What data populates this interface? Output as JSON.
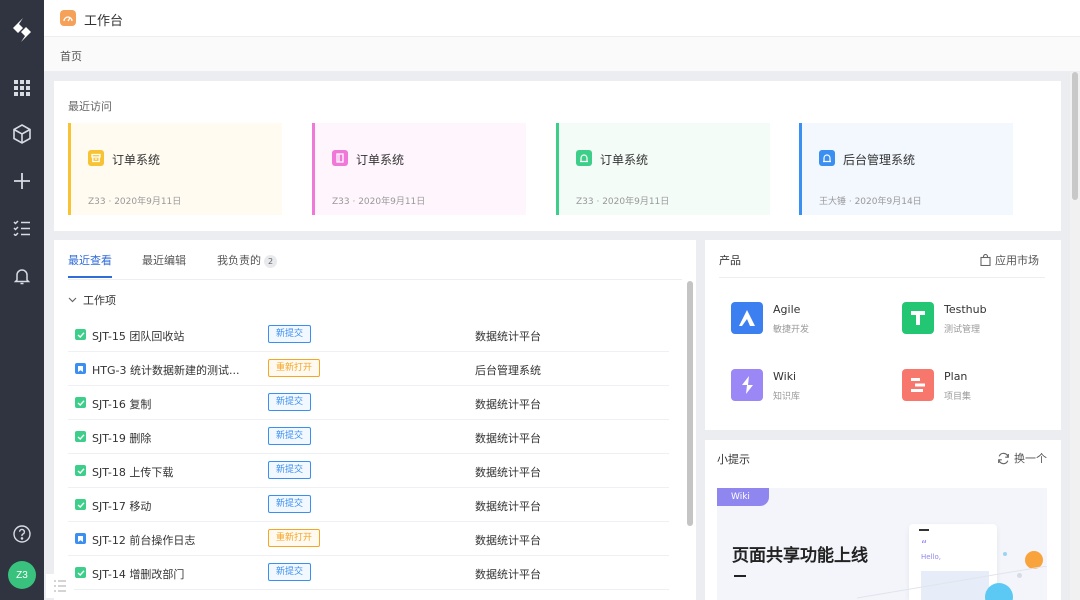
{
  "app": {
    "title": "工作台"
  },
  "breadcrumb": {
    "home": "首页"
  },
  "rail": {
    "avatar": "Z3"
  },
  "recent": {
    "title": "最近访问",
    "cards": [
      {
        "name": "订单系统",
        "meta": "Z33 · 2020年9月11日",
        "accent": "#f7c233",
        "bg": "#fffbf1"
      },
      {
        "name": "订单系统",
        "meta": "Z33 · 2020年9月11日",
        "accent": "#ef78d8",
        "bg": "#fff5fd"
      },
      {
        "name": "订单系统",
        "meta": "Z33 · 2020年9月11日",
        "accent": "#3dcf8a",
        "bg": "#f3fcf7"
      },
      {
        "name": "后台管理系统",
        "meta": "王大锤 · 2020年9月14日",
        "accent": "#3a8ff0",
        "bg": "#f3f8ff"
      }
    ]
  },
  "tabs": {
    "recent_view": "最近查看",
    "recent_edit": "最近编辑",
    "my_owned": "我负责的",
    "my_owned_count": "2"
  },
  "work": {
    "group": "工作项",
    "rows": [
      {
        "key": "SJT-15",
        "title": "团队回收站",
        "status": "新提交",
        "project": "数据统计平台",
        "type": "task"
      },
      {
        "key": "HTG-3",
        "title": "统计数据新建的测试...",
        "status": "重新打开",
        "project": "后台管理系统",
        "type": "story"
      },
      {
        "key": "SJT-16",
        "title": "复制",
        "status": "新提交",
        "project": "数据统计平台",
        "type": "task"
      },
      {
        "key": "SJT-19",
        "title": "删除",
        "status": "新提交",
        "project": "数据统计平台",
        "type": "task"
      },
      {
        "key": "SJT-18",
        "title": "上传下载",
        "status": "新提交",
        "project": "数据统计平台",
        "type": "task"
      },
      {
        "key": "SJT-17",
        "title": "移动",
        "status": "新提交",
        "project": "数据统计平台",
        "type": "task"
      },
      {
        "key": "SJT-12",
        "title": "前台操作日志",
        "status": "重新打开",
        "project": "数据统计平台",
        "type": "story"
      },
      {
        "key": "SJT-14",
        "title": "增删改部门",
        "status": "新提交",
        "project": "数据统计平台",
        "type": "task"
      }
    ]
  },
  "products": {
    "title": "产品",
    "market": "应用市场",
    "items": [
      {
        "name": "Agile",
        "desc": "敏捷开发",
        "color": "#3b7ff0",
        "icon": "agile-icon"
      },
      {
        "name": "Testhub",
        "desc": "测试管理",
        "color": "#22c673",
        "icon": "testhub-icon"
      },
      {
        "name": "Wiki",
        "desc": "知识库",
        "color": "#9b87f5",
        "icon": "wiki-icon"
      },
      {
        "name": "Plan",
        "desc": "项目集",
        "color": "#f8776c",
        "icon": "plan-icon"
      }
    ]
  },
  "tips": {
    "title": "小提示",
    "refresh": "换一个",
    "tag": "Wiki",
    "headline": "页面共享功能上线",
    "mock_hello": "Hello,",
    "mock_quote": "“"
  },
  "colors": {
    "primary": "#2f6bd9",
    "new_status": "#3a8ff0",
    "reopen_status": "#f5a623"
  }
}
